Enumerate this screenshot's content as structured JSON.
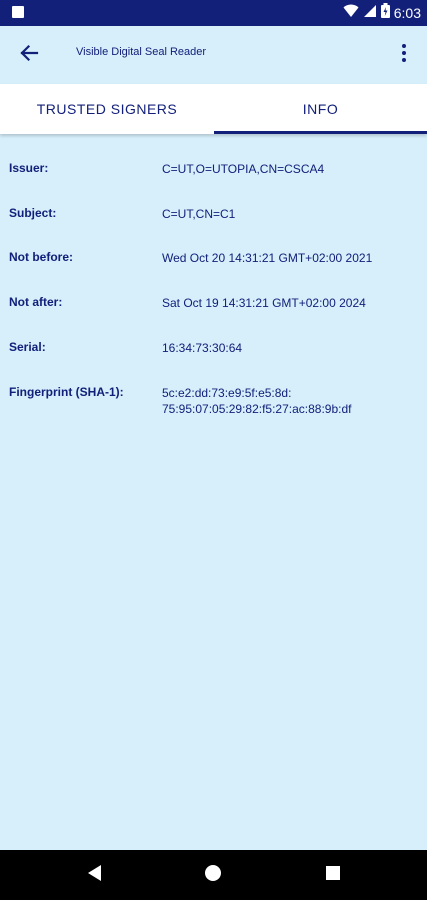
{
  "status_bar": {
    "time": "6:03",
    "icons": [
      "wifi-icon",
      "signal-icon",
      "battery-icon"
    ]
  },
  "app_bar": {
    "title": "Visible Digital Seal Reader",
    "back_icon": "arrow-left-icon",
    "menu_icon": "more-vert-icon"
  },
  "tabs": [
    {
      "label": "TRUSTED SIGNERS",
      "selected": false
    },
    {
      "label": "INFO",
      "selected": true
    }
  ],
  "info": {
    "issuer": {
      "label": "Issuer:",
      "value": "C=UT,O=UTOPIA,CN=CSCA4"
    },
    "subject": {
      "label": "Subject:",
      "value": "C=UT,CN=C1"
    },
    "not_before": {
      "label": "Not before:",
      "value": "Wed Oct 20 14:31:21 GMT+02:00 2021"
    },
    "not_after": {
      "label": "Not after:",
      "value": "Sat Oct 19 14:31:21 GMT+02:00 2024"
    },
    "serial": {
      "label": "Serial:",
      "value": "16:34:73:30:64"
    },
    "fingerprint": {
      "label": "Fingerprint (SHA-1):",
      "value_line1": "5c:e2:dd:73:e9:5f:e5:8d:",
      "value_line2": "75:95:07:05:29:82:f5:27:ac:88:9b:df"
    }
  },
  "colors": {
    "primary": "#13207a",
    "background": "#d6effb",
    "tab_background": "#ffffff"
  }
}
